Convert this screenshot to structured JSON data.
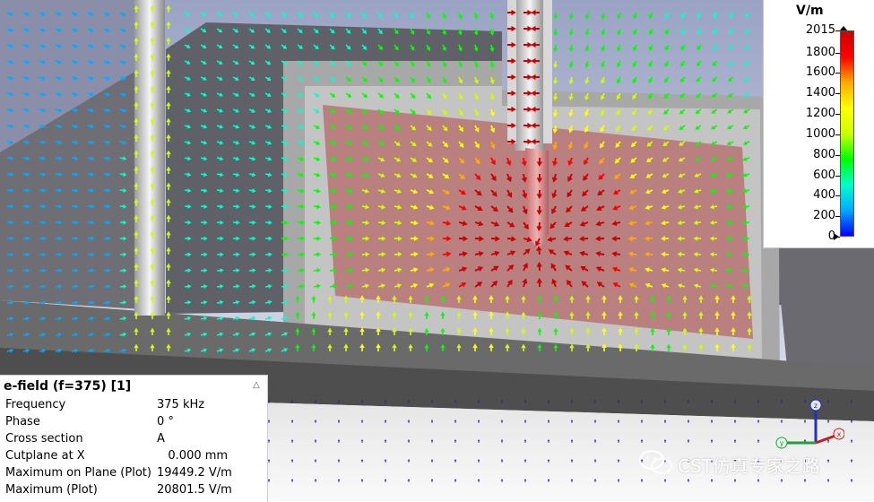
{
  "legend": {
    "unit": "V/m",
    "ticks": [
      "2015",
      "1800",
      "1600",
      "1400",
      "1200",
      "1000",
      "800",
      "600",
      "400",
      "200",
      "0"
    ],
    "tick_values": [
      2015,
      1800,
      1600,
      1400,
      1200,
      1000,
      800,
      600,
      400,
      200,
      0
    ],
    "max_value": 2015,
    "colors": [
      "#0000ff",
      "#00aaff",
      "#00ffcc",
      "#00ff00",
      "#ccff00",
      "#ffff00",
      "#ffaa00",
      "#ff0000",
      "#cc0000"
    ]
  },
  "info_panel": {
    "title": "e-field (f=375) [1]",
    "rows": [
      {
        "key": "Frequency",
        "value": "375 kHz"
      },
      {
        "key": "Phase",
        "value": "0 °"
      },
      {
        "key": "Cross section",
        "value": "A"
      },
      {
        "key": "Cutplane at X",
        "value": "   0.000 mm"
      },
      {
        "key": "Maximum on Plane (Plot)",
        "value": "19449.2 V/m"
      },
      {
        "key": "Maximum (Plot)",
        "value": "20801.5 V/m"
      }
    ]
  },
  "axes": {
    "x": "x",
    "y": "y",
    "z": "z"
  },
  "watermark": {
    "text": "CST仿真专家之路"
  },
  "icons": [
    "collapse-icon",
    "axis-triad-icon",
    "wechat-icon"
  ]
}
